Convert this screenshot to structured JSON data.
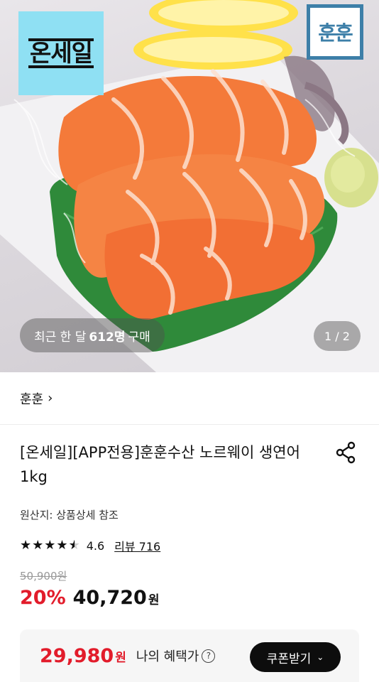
{
  "hero": {
    "onsale_logo": "온세일",
    "brand_logo": "훈훈",
    "buyers_prefix": "최근 한 달",
    "buyers_count": "612명",
    "buyers_suffix": "구매",
    "page_indicator": "1 / 2"
  },
  "store": {
    "name": "훈훈",
    "chevron": "›"
  },
  "product": {
    "title": "[온세일][APP전용]훈훈수산 노르웨이 생연어 1kg",
    "origin": "원산지: 상품상세 참조",
    "rating": {
      "stars_value": 4.6,
      "score": "4.6",
      "reviews_label": "리뷰 716"
    },
    "original_price": "50,900원",
    "discount": "20%",
    "sale_price": "40,720",
    "sale_unit": "원"
  },
  "benefit": {
    "price": "29,980",
    "unit": "원",
    "label": "나의 혜택가",
    "help_icon": "?",
    "coupon_label": "쿠폰받기",
    "coupon_chevron": "⌄"
  },
  "colors": {
    "accent_red": "#e21c2b",
    "onsale_bg": "#8fe0f3",
    "brand_blue": "#3d7fa8"
  }
}
